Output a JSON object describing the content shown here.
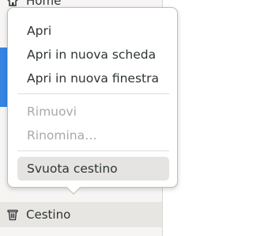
{
  "sidebar": {
    "home_label": "Home",
    "trash_label": "Cestino",
    "home_icon": "home-icon",
    "trash_icon": "trash-icon"
  },
  "context_menu": {
    "items": [
      {
        "label": "Apri",
        "enabled": true
      },
      {
        "label": "Apri in nuova scheda",
        "enabled": true
      },
      {
        "label": "Apri in nuova finestra",
        "enabled": true
      },
      {
        "label": "Rimuovi",
        "enabled": false
      },
      {
        "label": "Rinomina…",
        "enabled": false
      },
      {
        "label": "Svuota cestino",
        "enabled": true,
        "hovered": true
      }
    ]
  },
  "colors": {
    "accent": "#3584e4",
    "sidebar_bg": "#f6f5f4",
    "disabled_text": "#a7a9a8"
  }
}
